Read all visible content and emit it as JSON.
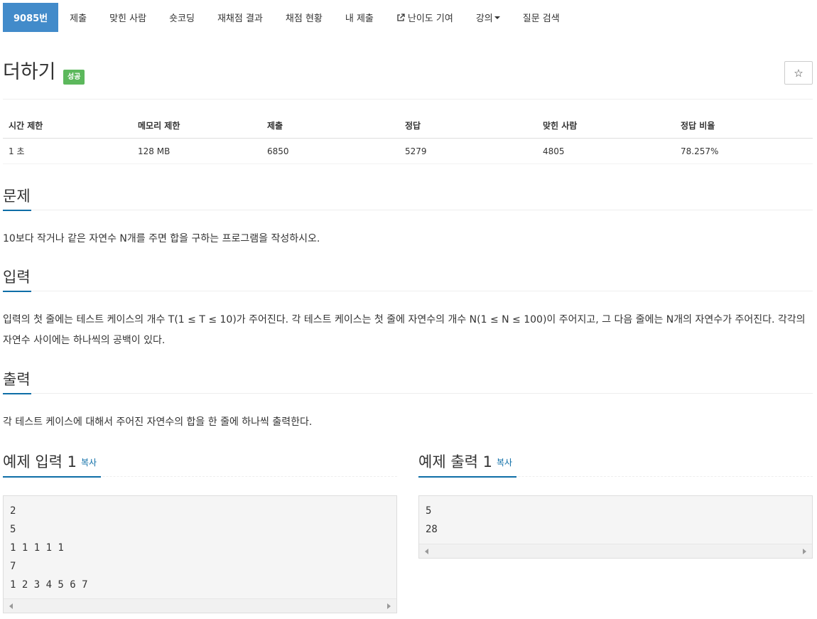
{
  "nav": {
    "items": [
      {
        "label": "9085번"
      },
      {
        "label": "제출"
      },
      {
        "label": "맞힌 사람"
      },
      {
        "label": "숏코딩"
      },
      {
        "label": "재채점 결과"
      },
      {
        "label": "채점 현황"
      },
      {
        "label": "내 제출"
      },
      {
        "label": "난이도 기여"
      },
      {
        "label": "강의"
      },
      {
        "label": "질문 검색"
      }
    ]
  },
  "problem": {
    "title": "더하기",
    "badge": "성공",
    "star": "☆"
  },
  "info": {
    "headers": [
      "시간 제한",
      "메모리 제한",
      "제출",
      "정답",
      "맞힌 사람",
      "정답 비율"
    ],
    "values": [
      "1 초",
      "128 MB",
      "6850",
      "5279",
      "4805",
      "78.257%"
    ]
  },
  "sections": {
    "problem": {
      "title": "문제",
      "text": "10보다 작거나 같은 자연수 N개를 주면 합을 구하는 프로그램을 작성하시오."
    },
    "input": {
      "title": "입력",
      "text": "입력의 첫 줄에는 테스트 케이스의 개수 T(1 ≤ T ≤ 10)가 주어진다. 각 테스트 케이스는 첫 줄에 자연수의 개수 N(1 ≤ N ≤ 100)이 주어지고, 그 다음 줄에는 N개의 자연수가 주어진다. 각각의 자연수 사이에는 하나씩의 공백이 있다."
    },
    "output": {
      "title": "출력",
      "text": "각 테스트 케이스에 대해서 주어진 자연수의 합을 한 줄에 하나씩 출력한다."
    }
  },
  "samples": {
    "input": {
      "title": "예제 입력 1",
      "copy": "복사",
      "content": "2\n5\n1 1 1 1 1\n7\n1 2 3 4 5 6 7"
    },
    "output": {
      "title": "예제 출력 1",
      "copy": "복사",
      "content": "5\n28"
    }
  }
}
